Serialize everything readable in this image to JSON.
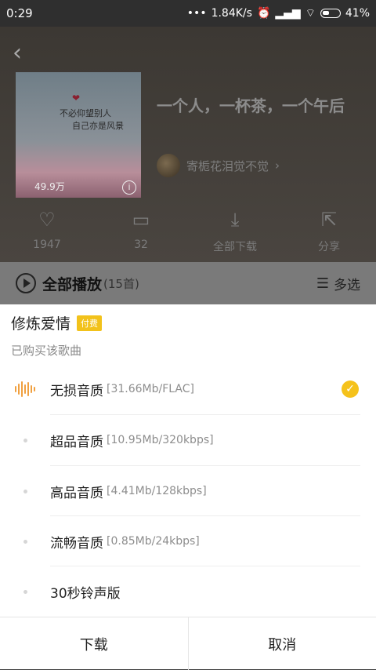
{
  "status_bar": {
    "time": "0:29",
    "network_speed": "1.84K/s",
    "battery": "41%"
  },
  "playlist": {
    "title": "一个人，一杯茶，一个午后",
    "creator": "寄栀花泪觉不觉",
    "play_count": "49.9万",
    "cover_text_line1": "不必仰望别人",
    "cover_text_line2": "自己亦是风景"
  },
  "actions": [
    {
      "icon": "heart-icon",
      "label": "1947"
    },
    {
      "icon": "comment-icon",
      "label": "32"
    },
    {
      "icon": "download-icon",
      "label": "全部下载"
    },
    {
      "icon": "share-icon",
      "label": "分享"
    }
  ],
  "play_bar": {
    "play_all_label": "全部播放",
    "count_label": "(15首)",
    "multi_select_label": "多选"
  },
  "sheet": {
    "song_name": "修炼爱情",
    "paid_badge": "付费",
    "purchased_note": "已购买该歌曲",
    "options": [
      {
        "label": "无损音质",
        "detail": "[31.66Mb/FLAC]",
        "selected": true
      },
      {
        "label": "超品音质",
        "detail": "[10.95Mb/320kbps]",
        "selected": false
      },
      {
        "label": "高品音质",
        "detail": "[4.41Mb/128kbps]",
        "selected": false
      },
      {
        "label": "流畅音质",
        "detail": "[0.85Mb/24kbps]",
        "selected": false
      },
      {
        "label": "30秒铃声版",
        "detail": "",
        "selected": false
      }
    ],
    "download_label": "下载",
    "cancel_label": "取消"
  },
  "colors": {
    "accent": "#f5c21b",
    "wave": "#f0a040"
  }
}
